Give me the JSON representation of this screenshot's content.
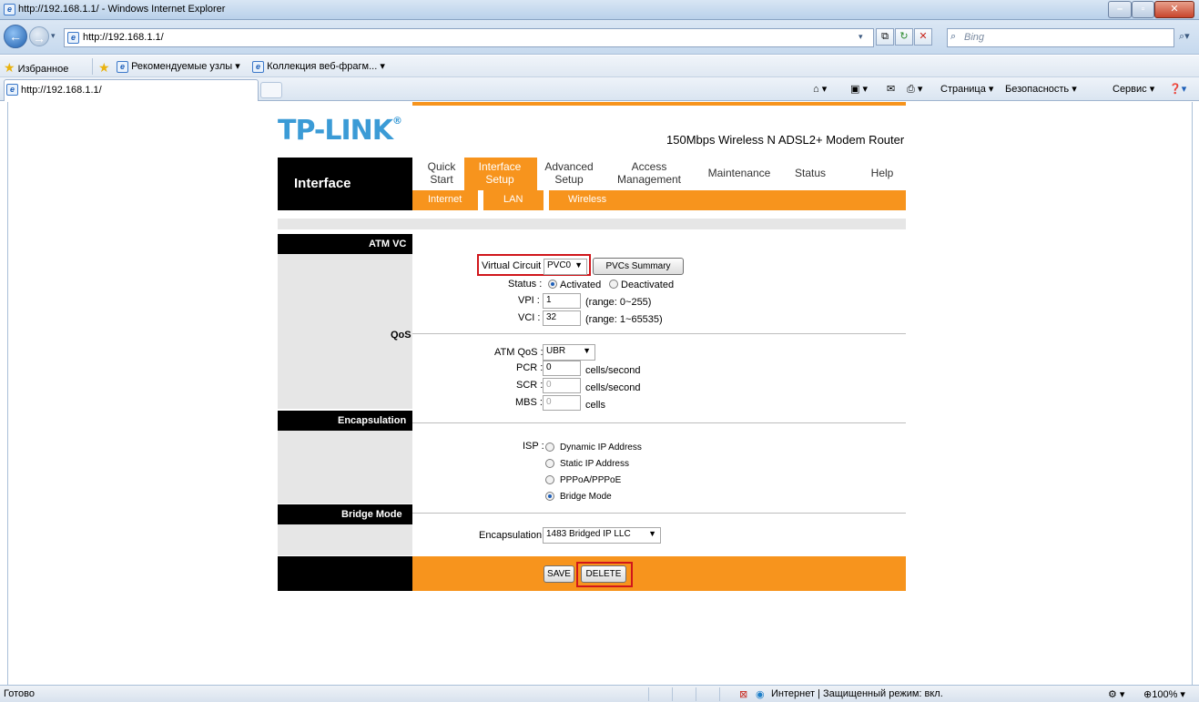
{
  "window": {
    "title": "http://192.168.1.1/ - Windows Internet Explorer"
  },
  "address_bar": {
    "url": "http://192.168.1.1/",
    "search_placeholder": "Bing"
  },
  "favorites_bar": {
    "favorites": "Избранное",
    "items": [
      "Рекомендуемые узлы ▾",
      "Коллекция веб-фрагм... ▾"
    ]
  },
  "tab": {
    "title": "http://192.168.1.1/"
  },
  "command_bar": {
    "page": "Страница ▾",
    "safety": "Безопасность ▾",
    "tools": "Сервис ▾"
  },
  "router": {
    "brand": "TP-LINK",
    "model": "150Mbps Wireless N ADSL2+ Modem Router",
    "section_title": "Interface",
    "nav": [
      {
        "line1": "Quick",
        "line2": "Start"
      },
      {
        "line1": "Interface",
        "line2": "Setup"
      },
      {
        "line1": "Advanced",
        "line2": "Setup"
      },
      {
        "line1": "Access",
        "line2": "Management"
      },
      {
        "line1": "Maintenance",
        "line2": ""
      },
      {
        "line1": "Status",
        "line2": ""
      },
      {
        "line1": "Help",
        "line2": ""
      }
    ],
    "subnav": [
      "Internet",
      "LAN",
      "Wireless"
    ],
    "sections": {
      "atm_vc": "ATM VC",
      "qos": "QoS",
      "encapsulation": "Encapsulation",
      "bridge_mode": "Bridge Mode"
    },
    "fields": {
      "virtual_circuit_label": "Virtual Circuit :",
      "virtual_circuit_value": "PVC0",
      "pvcs_summary": "PVCs Summary",
      "status_label": "Status :",
      "status_activated": "Activated",
      "status_deactivated": "Deactivated",
      "vpi_label": "VPI :",
      "vpi_value": "1",
      "vpi_range": "(range: 0~255)",
      "vci_label": "VCI :",
      "vci_value": "32",
      "vci_range": "(range: 1~65535)",
      "atm_qos_label": "ATM QoS :",
      "atm_qos_value": "UBR",
      "pcr_label": "PCR :",
      "pcr_value": "0",
      "pcr_unit": "cells/second",
      "scr_label": "SCR :",
      "scr_value": "0",
      "scr_unit": "cells/second",
      "mbs_label": "MBS :",
      "mbs_value": "0",
      "mbs_unit": "cells",
      "isp_label": "ISP :",
      "isp_options": [
        "Dynamic IP Address",
        "Static IP Address",
        "PPPoA/PPPoE",
        "Bridge Mode"
      ],
      "encap_label": "Encapsulation :",
      "encap_value": "1483 Bridged IP LLC"
    },
    "buttons": {
      "save": "SAVE",
      "delete": "DELETE"
    }
  },
  "status_bar": {
    "left": "Готово",
    "zone": "Интернет | Защищенный режим: вкл.",
    "zoom": "100%"
  }
}
